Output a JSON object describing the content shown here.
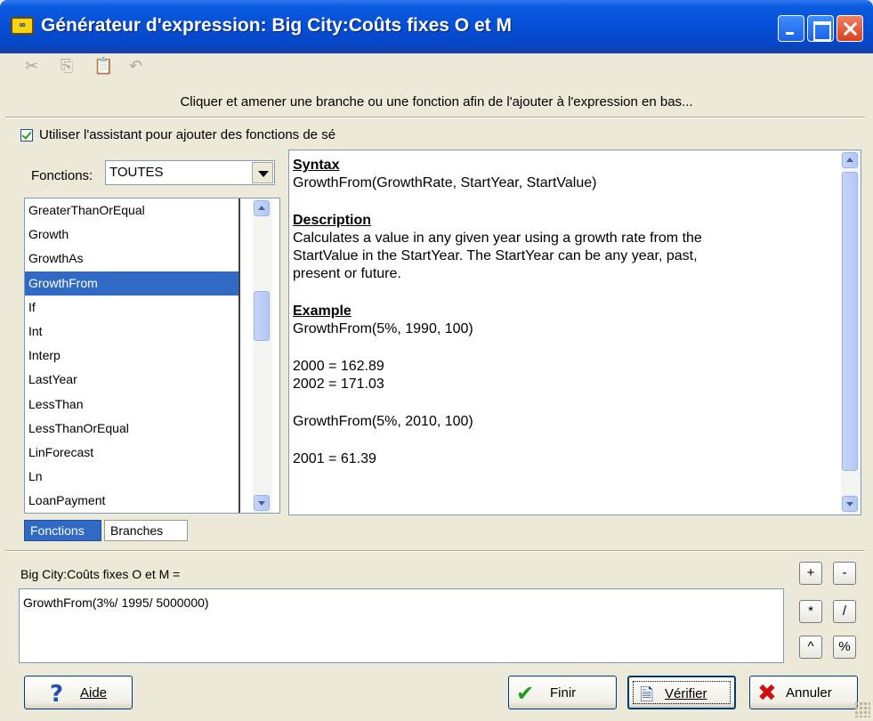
{
  "window": {
    "title": "Générateur d'expression: Big City:Coûts fixes O et M",
    "icon_text": "∞"
  },
  "toolbar": {
    "cut_icon": "✂",
    "copy_icon": "⎘",
    "paste_icon": "📋",
    "undo_icon": "↶"
  },
  "hint": "Cliquer et amener une branche ou une fonction afin de l'ajouter à l'expression en bas...",
  "wizard_checkbox": {
    "label": "Utiliser l'assistant pour ajouter des fonctions de sé",
    "checked": true
  },
  "functions": {
    "label": "Fonctions:",
    "selected_filter": "TOUTES",
    "items": [
      "GreaterThanOrEqual",
      "Growth",
      "GrowthAs",
      "GrowthFrom",
      "If",
      "Int",
      "Interp",
      "LastYear",
      "LessThan",
      "LessThanOrEqual",
      "LinForecast",
      "Ln",
      "LoanPayment"
    ],
    "selected_item": "GrowthFrom"
  },
  "help": {
    "syntax_heading": "Syntax",
    "syntax": "GrowthFrom(GrowthRate, StartYear, StartValue)",
    "description_heading": "Description",
    "description_lines": [
      "Calculates a value in any given year using a growth rate from the",
      "StartValue in the StartYear.  The StartYear can be any year, past,",
      "present or future."
    ],
    "example_heading": "Example",
    "example1": "GrowthFrom(5%, 1990, 100)",
    "example1_r1": "2000 = 162.89",
    "example1_r2": "2002 = 171.03",
    "example2": "GrowthFrom(5%, 2010, 100)",
    "example2_r1": "2001 = 61.39"
  },
  "tabs": {
    "functions": "Fonctions",
    "branches": "Branches"
  },
  "expression": {
    "label": "Big City:Coûts fixes O et M =",
    "value": "GrowthFrom(3%/ 1995/ 5000000)"
  },
  "operators": {
    "plus": "+",
    "minus": "-",
    "times": "*",
    "divide": "/",
    "power": "^",
    "percent": "%"
  },
  "buttons": {
    "help": "Aide",
    "finish": "Finir",
    "verify": "Vérifier",
    "cancel": "Annuler"
  }
}
